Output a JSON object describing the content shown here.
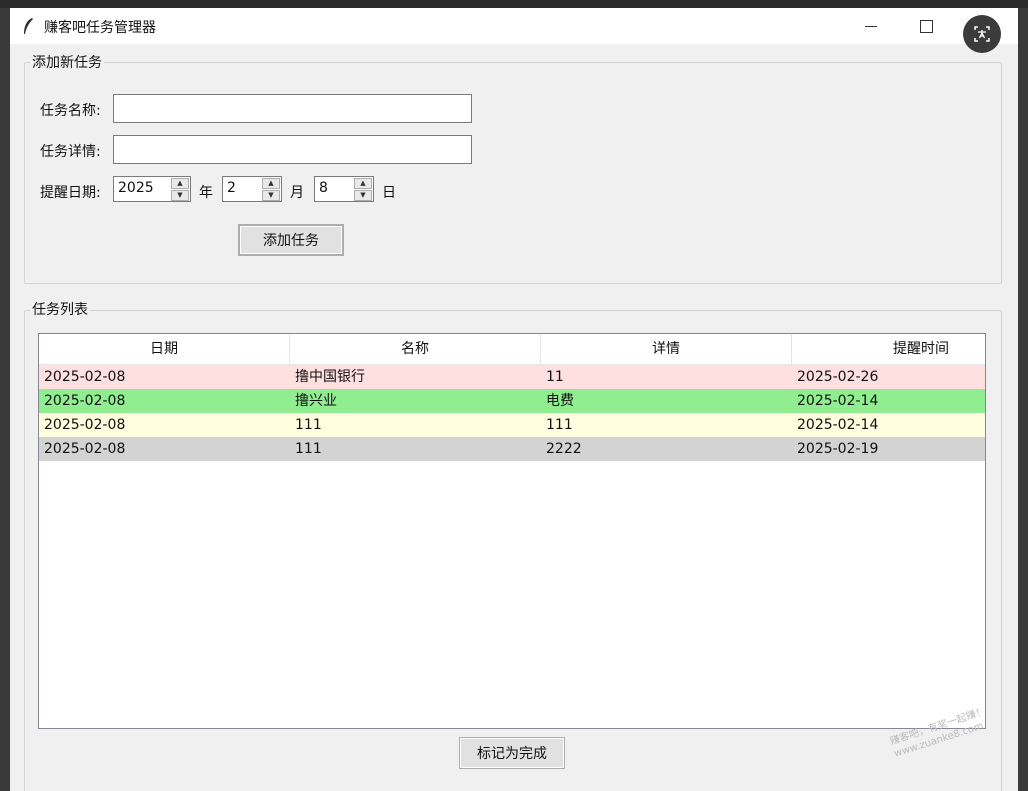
{
  "window": {
    "title": "赚客吧任务管理器"
  },
  "add_section": {
    "legend": "添加新任务",
    "name_label": "任务名称:",
    "name_value": "",
    "detail_label": "任务详情:",
    "detail_value": "",
    "date_label": "提醒日期:",
    "year_value": "2025",
    "year_unit": "年",
    "month_value": "2",
    "month_unit": "月",
    "day_value": "8",
    "day_unit": "日",
    "add_button": "添加任务"
  },
  "list_section": {
    "legend": "任务列表",
    "columns": [
      "日期",
      "名称",
      "详情",
      "提醒时间"
    ],
    "rows": [
      {
        "date": "2025-02-08",
        "name": "撸中国银行",
        "detail": "11",
        "remind": "2025-02-26",
        "color": "#ffe0e0"
      },
      {
        "date": "2025-02-08",
        "name": "撸兴业",
        "detail": "电费",
        "remind": "2025-02-14",
        "color": "#90ee90"
      },
      {
        "date": "2025-02-08",
        "name": "111",
        "detail": "111",
        "remind": "2025-02-14",
        "color": "#ffffe0"
      },
      {
        "date": "2025-02-08",
        "name": "111",
        "detail": "2222",
        "remind": "2025-02-19",
        "color": "#d3d3d3"
      }
    ],
    "done_button": "标记为完成"
  },
  "watermark": {
    "line1": "赚客吧，有奖一起赚！",
    "line2": "www.zuanke8.com"
  },
  "icons": {
    "app": "feather-icon",
    "translate": "translate-icon"
  }
}
